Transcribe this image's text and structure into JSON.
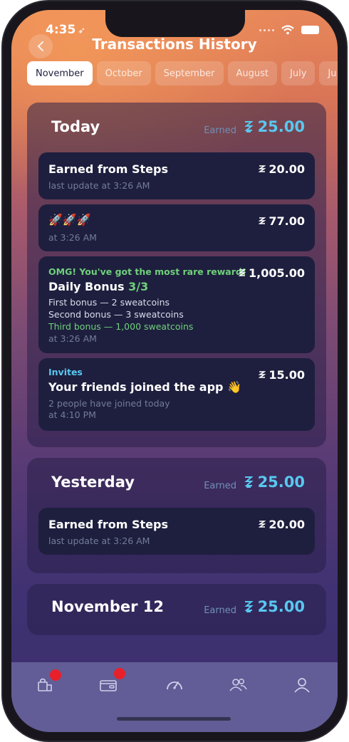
{
  "status": {
    "time": "4:35",
    "location_icon": "location-arrow-icon"
  },
  "header": {
    "title": "Transactions History",
    "back_icon": "chevron-left-icon"
  },
  "months": [
    "November",
    "October",
    "September",
    "August",
    "July",
    "Ju"
  ],
  "sections": [
    {
      "title": "Today",
      "earned_label": "Earned",
      "amount": "25.00",
      "cards": [
        {
          "title": "Earned from Steps",
          "sub": "last update at 3:26 AM",
          "amount": "20.00"
        },
        {
          "title": "🚀🚀🚀",
          "sub": "at 3:26 AM",
          "amount": "77.00"
        },
        {
          "banner": "OMG! You've got the most rare reward!",
          "title": "Daily Bonus",
          "progress": "3/3",
          "lines": [
            "First bonus — 2 sweatcoins",
            "Second bonus — 3 sweatcoins",
            "Third bonus — 1,000 sweatcoins"
          ],
          "sub": "at 3:26 AM",
          "amount": "1,005.00"
        },
        {
          "tag": "Invites",
          "title": "Your friends joined the app 👋",
          "line": "2 people have joined today",
          "sub": "at 4:10 PM",
          "amount": "15.00"
        }
      ]
    },
    {
      "title": "Yesterday",
      "earned_label": "Earned",
      "amount": "25.00",
      "cards": [
        {
          "title": "Earned from Steps",
          "sub": "last update at 3:26 AM",
          "amount": "20.00"
        }
      ]
    },
    {
      "title": "November 12",
      "earned_label": "Earned",
      "amount": "25.00"
    }
  ],
  "colors": {
    "accent": "#58c8f0",
    "green": "#6fd07a",
    "badge": "#e8202a",
    "card": "#1e1f3e"
  },
  "tabbar": {
    "icons": [
      "shop-bag-icon",
      "wallet-icon",
      "speedometer-icon",
      "friends-icon",
      "profile-icon"
    ]
  }
}
